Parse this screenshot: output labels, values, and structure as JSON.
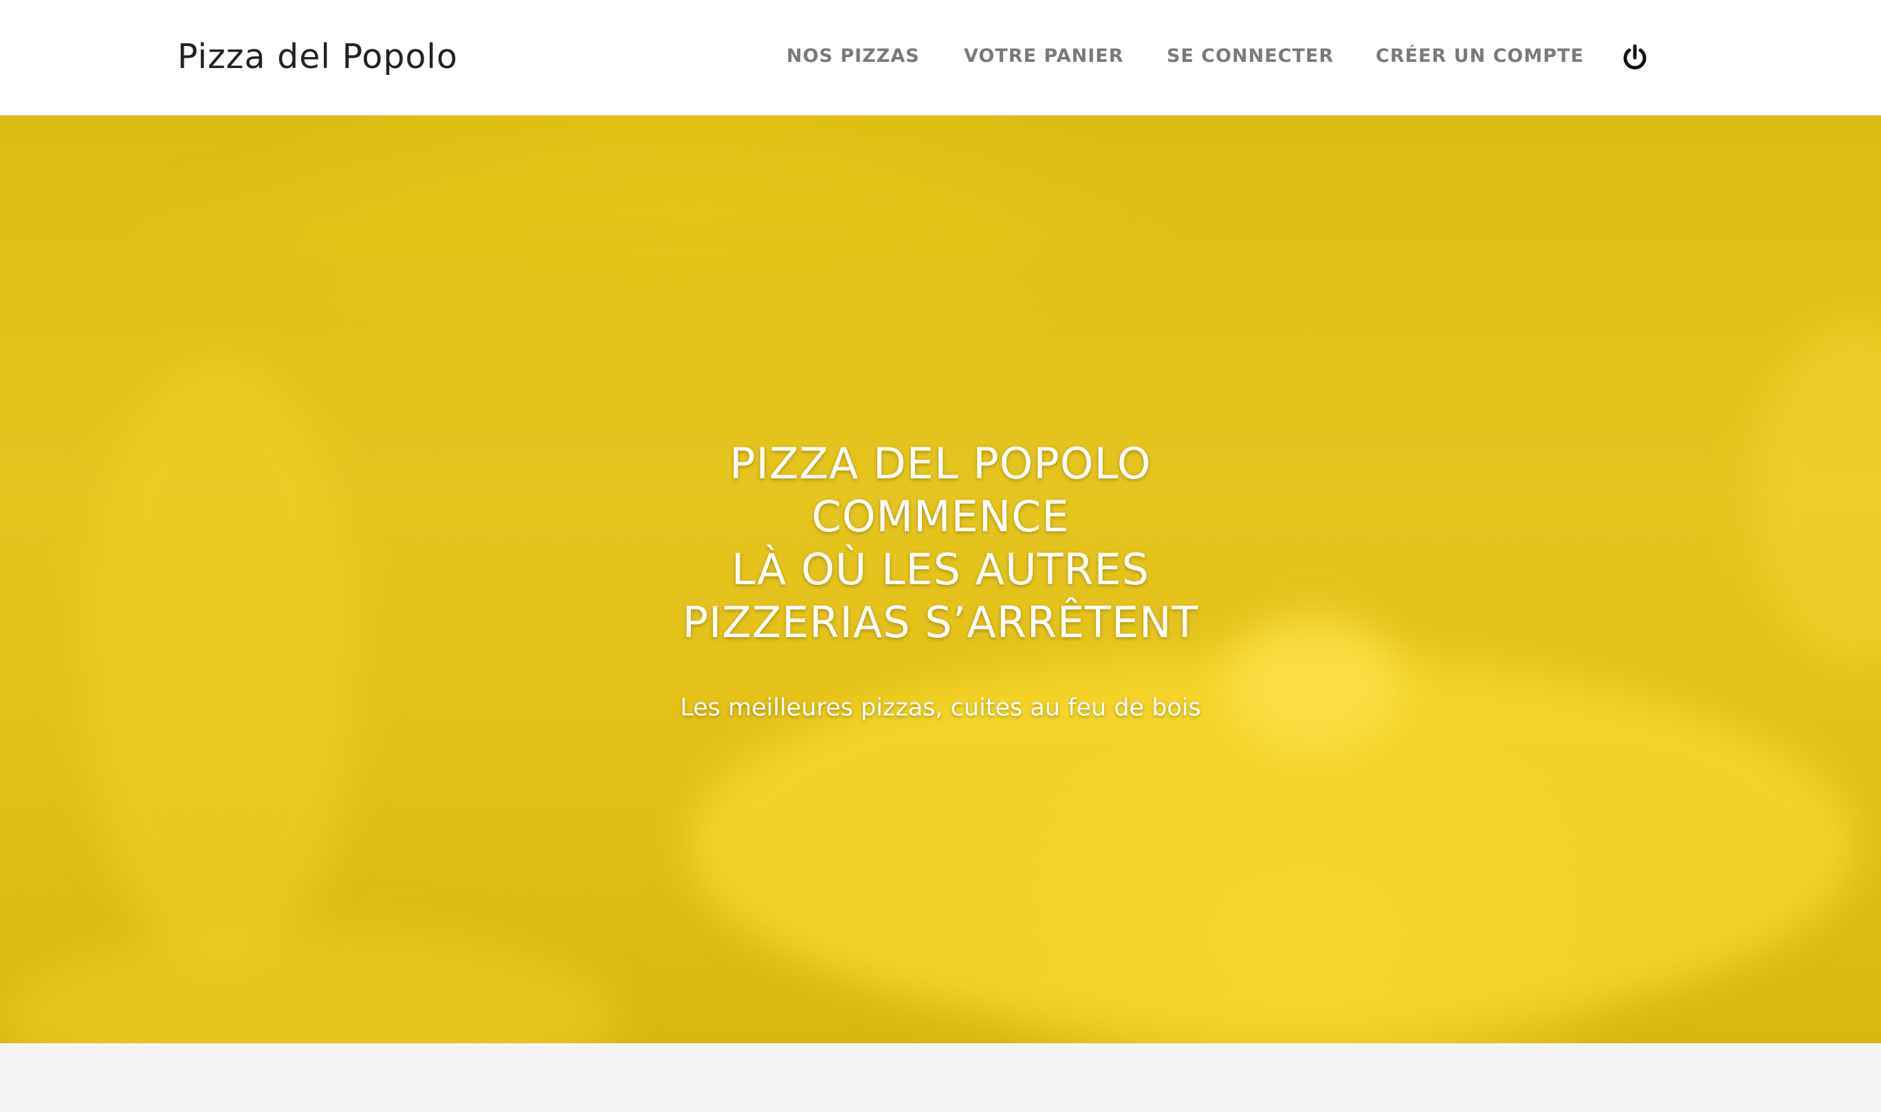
{
  "brand": {
    "name": "Pizza del Popolo"
  },
  "nav": {
    "items": [
      {
        "label": "NOS PIZZAS"
      },
      {
        "label": "VOTRE PANIER"
      },
      {
        "label": "SE CONNECTER"
      },
      {
        "label": "CRÉER UN COMPTE"
      }
    ],
    "power_icon": "power-icon"
  },
  "hero": {
    "title_lines": [
      "PIZZA DEL POPOLO",
      "COMMENCE",
      "LÀ OÙ LES AUTRES",
      "PIZZERIAS S’ARRÊTENT"
    ],
    "subtitle": "Les meilleures pizzas, cuites au feu de bois",
    "overlay_color": "#e2c016"
  },
  "colors": {
    "nav_text": "#7a7a7a",
    "brand_text": "#222222",
    "hero_text": "#ffffff",
    "page_bg": "#f4f4f4"
  }
}
